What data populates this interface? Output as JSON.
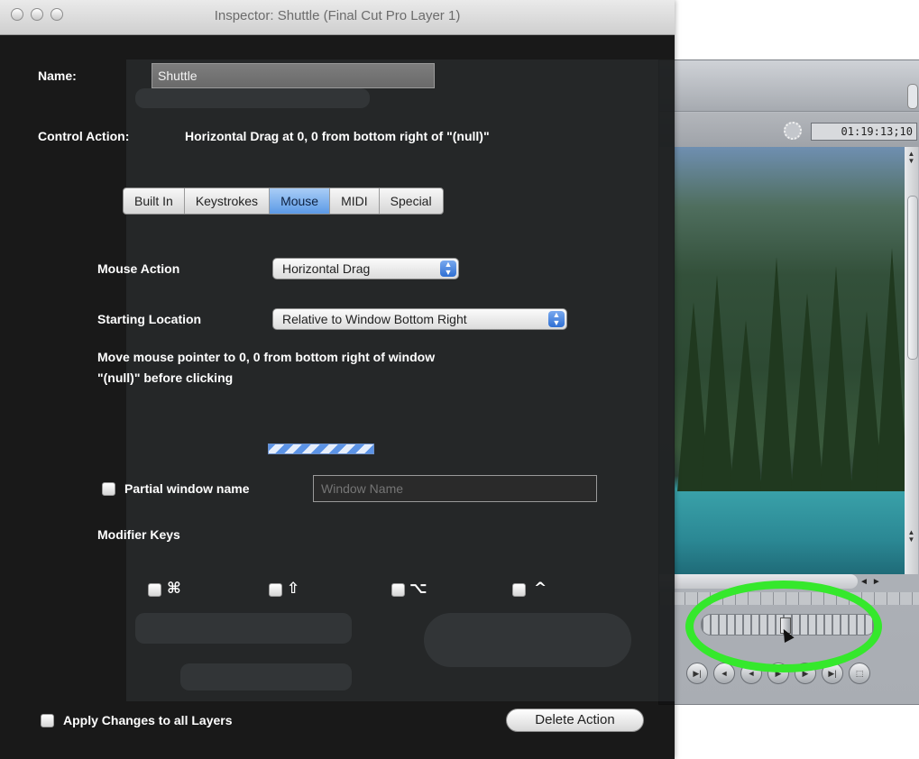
{
  "fcp_window": {
    "timecode": "01:19:13;10",
    "hscroll_left": "◄",
    "hscroll_right": "►",
    "transport_icons": [
      "▶|",
      "◄",
      "◄",
      "▶",
      "▶",
      "▶|",
      "⬚"
    ]
  },
  "inspector": {
    "title": "Inspector: Shuttle (Final Cut Pro Layer 1)",
    "name_label": "Name:",
    "name_value": "Shuttle",
    "control_action_label": "Control Action:",
    "control_action_value": "Horizontal Drag at 0, 0 from bottom right of \"(null)\"",
    "tabs": [
      "Built In",
      "Keystrokes",
      "Mouse",
      "MIDI",
      "Special"
    ],
    "active_tab": "Mouse",
    "mouse_action_label": "Mouse Action",
    "mouse_action_value": "Horizontal Drag",
    "starting_location_label": "Starting Location",
    "starting_location_value": "Relative to Window Bottom Right",
    "description_line1": "Move mouse pointer to 0, 0 from bottom right of window",
    "description_line2": "\"(null)\" before clicking",
    "partial_window_label": "Partial window name",
    "window_name_placeholder": "Window Name",
    "modifier_keys_label": "Modifier Keys",
    "modifiers": [
      "⌘",
      "⇧",
      "⌥",
      "^"
    ],
    "apply_all_label": "Apply Changes to all Layers",
    "delete_button": "Delete Action"
  },
  "colors": {
    "highlight_ring": "#35e82c",
    "active_tab": "#5c9ae6",
    "inspector_bg": "#080808"
  }
}
